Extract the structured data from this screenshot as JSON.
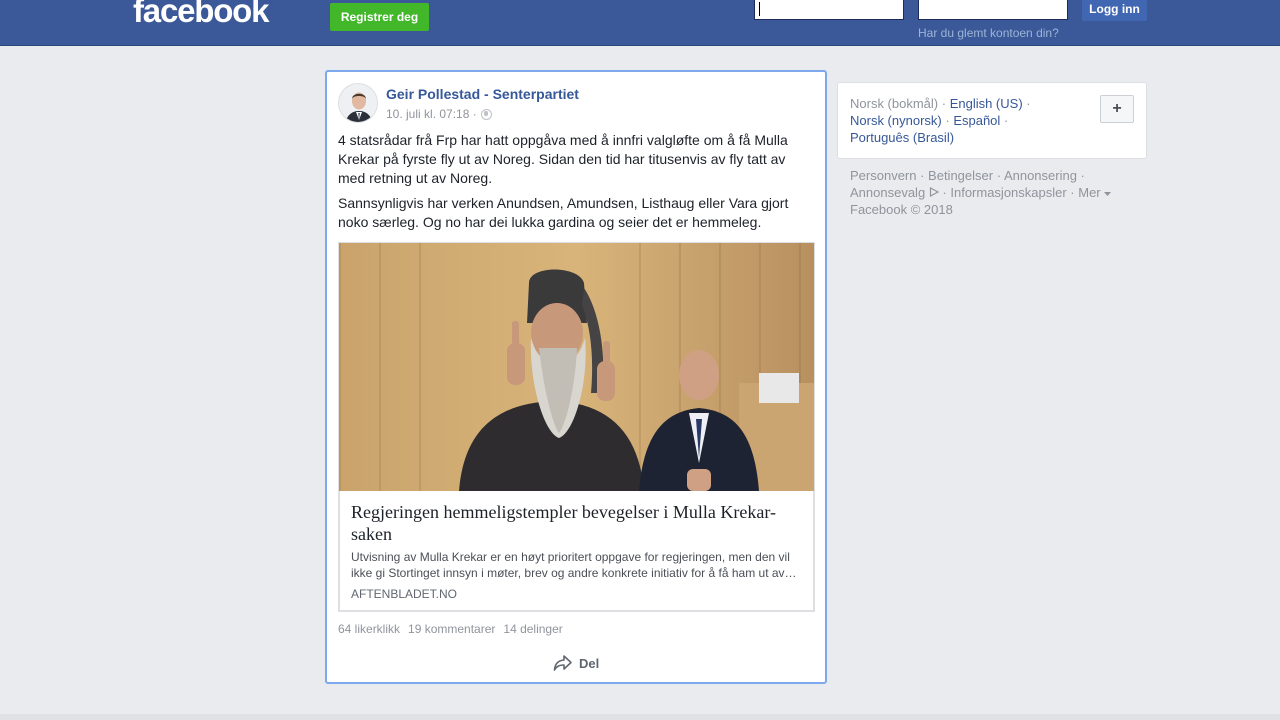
{
  "header": {
    "logo": "facebook",
    "register_label": "Registrer deg",
    "login_label": "Logg inn",
    "forgot_label": "Har du glemt kontoen din?"
  },
  "post": {
    "author": "Geir Pollestad - Senterpartiet",
    "timestamp": "10. juli kl. 07:18 ·",
    "paragraph_1": "4 statsrådar frå Frp har hatt oppgåva med å innfri valgløfte om å få Mulla Krekar på fyrste fly ut av Noreg. Sidan den tid har titusenvis av fly tatt av med retning ut av Noreg.",
    "paragraph_2": "Sannsynligvis har verken Anundsen, Amundsen, Listhaug eller Vara gjort noko særleg. Og no har dei lukka gardina og seier det er hemmeleg.",
    "link": {
      "title": "Regjeringen hemmeligstempler bevegelser i Mulla Krekar-saken",
      "description": "Utvisning av Mulla Krekar er en høyt prioritert oppgave for regjeringen, men den vil ikke gi Stortinget innsyn i møter, brev og andre konkrete initiativ for å få ham ut av…",
      "domain": "AFTENBLADET.NO"
    },
    "stats": {
      "likes": "64 likerklikk",
      "comments": "19 kommentarer",
      "shares": "14 delinger"
    },
    "share_label": "Del"
  },
  "sidebar": {
    "languages": {
      "current": "Norsk (bokmål)",
      "en": "English (US)",
      "nn": "Norsk (nynorsk)",
      "es": "Español",
      "pt": "Português (Brasil)",
      "sep": " · "
    },
    "add_label": "+",
    "footer": {
      "privacy": "Personvern",
      "terms": "Betingelser",
      "ads": "Annonsering",
      "adchoices": "Annonsevalg",
      "cookies": "Informasjonskapsler",
      "more": "Mer",
      "copyright": "Facebook © 2018"
    }
  },
  "colors": {
    "brand": "#3b5998",
    "register": "#42b72a",
    "link": "#365899",
    "focus_border": "#7fa9ee"
  }
}
